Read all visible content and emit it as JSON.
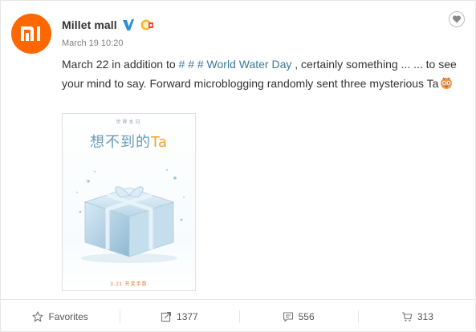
{
  "post": {
    "author": "Millet mall",
    "timestamp": "March 19 10:20",
    "text_before": "March 22 in addition to ",
    "topic": "# # # World Water Day",
    "text_after": " , certainly something ... ... to see your mind to say. Forward microblogging randomly sent three mysterious Ta",
    "avatar_logo": "mi-logo",
    "verified_icon": "verified-v-icon",
    "badge_icon": "vip-badge-icon",
    "emoji": "mystery-face-emoji"
  },
  "media": {
    "small_caption": "世界水日",
    "title_main": "想不到的",
    "title_accent": "Ta",
    "footer_tag": "3.21 开奖手数",
    "image_subject": "ice-gift-box"
  },
  "actions": {
    "favorites_label": "Favorites",
    "forward_count": "1377",
    "comment_count": "556",
    "like_count": "313"
  },
  "colors": {
    "brand": "#ff6700",
    "link": "#3a7a9a",
    "verified": "#2d8fd9"
  }
}
